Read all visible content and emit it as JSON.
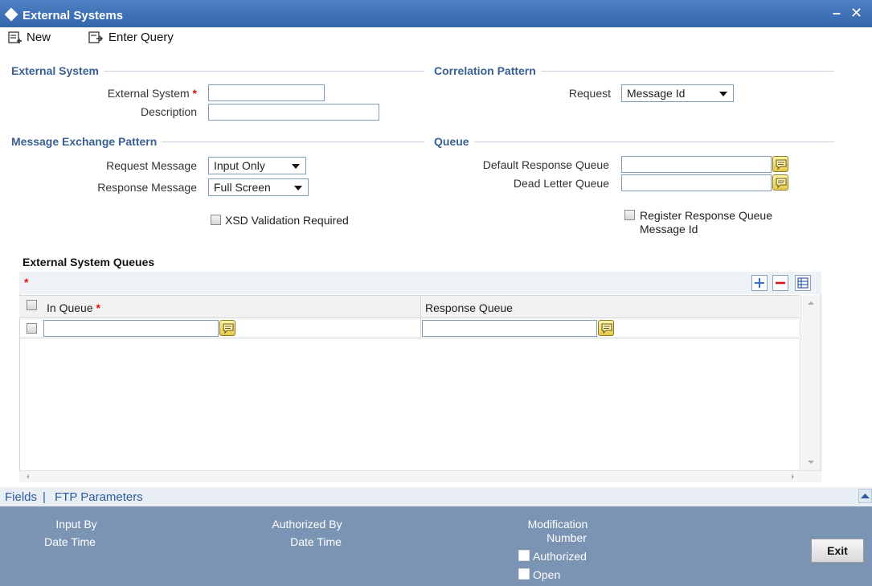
{
  "window": {
    "title": "External Systems",
    "minimize": "–",
    "close": "✕"
  },
  "toolbar": {
    "new_label": "New",
    "enter_query_label": "Enter Query"
  },
  "sections": {
    "external_system": "External System",
    "correlation_pattern": "Correlation Pattern",
    "message_exchange_pattern": "Message Exchange Pattern",
    "queue": "Queue"
  },
  "external_system": {
    "external_system_label": "External System",
    "external_system_value": "",
    "description_label": "Description",
    "description_value": ""
  },
  "correlation": {
    "request_label": "Request",
    "request_value": "Message Id"
  },
  "message_exchange": {
    "request_message_label": "Request Message",
    "request_message_value": "Input Only",
    "response_message_label": "Response Message",
    "response_message_value": "Full Screen",
    "xsd_label": "XSD Validation Required"
  },
  "queue": {
    "default_response_label": "Default Response Queue",
    "default_response_value": "",
    "dead_letter_label": "Dead Letter Queue",
    "dead_letter_value": "",
    "register_label_1": "Register Response Queue",
    "register_label_2": "Message Id"
  },
  "queues_grid": {
    "title": "External System Queues",
    "required_mark": "*",
    "columns": [
      "In Queue",
      "Response Queue"
    ],
    "rows": [
      {
        "in_queue": "",
        "response_queue": ""
      }
    ]
  },
  "footer": {
    "tab_fields": "Fields",
    "separator": "|",
    "tab_ftp": "FTP Parameters",
    "input_by": "Input By",
    "date_time_1": "Date Time",
    "authorized_by": "Authorized By",
    "date_time_2": "Date Time",
    "modification_1": "Modification",
    "modification_2": "Number",
    "authorized": "Authorized",
    "open": "Open",
    "exit_label": "Exit"
  },
  "colors": {
    "title_bar": "#2f61a8",
    "section_heading": "#3a5f91",
    "audit_bar": "#7c94b3",
    "required": "#dd1111"
  }
}
